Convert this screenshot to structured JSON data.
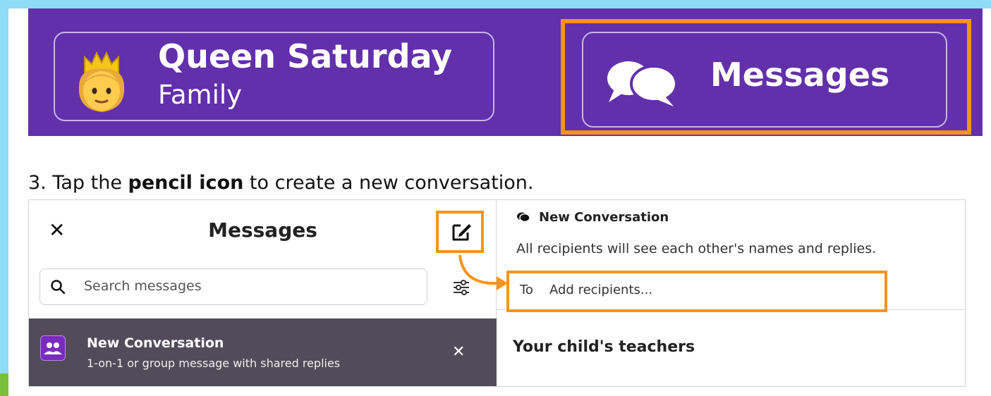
{
  "banner": {
    "profile_name": "Queen Saturday",
    "profile_role": "Family",
    "messages_label": "Messages",
    "background_color": "#6230ab"
  },
  "instruction": {
    "prefix": "3. Tap the ",
    "emphasis": "pencil icon",
    "suffix": " to create a new conversation."
  },
  "sidebar": {
    "title": "Messages",
    "close_icon": "x-icon",
    "compose_icon": "pencil-square-icon",
    "search_placeholder": "Search messages",
    "filter_icon": "sliders-icon"
  },
  "conversation_item": {
    "title": "New Conversation",
    "subtitle": "1-on-1 or group message with shared replies",
    "avatar_icon": "people-icon",
    "close_icon": "x-icon"
  },
  "composer": {
    "title": "New Conversation",
    "note": "All recipients will see each other's names and replies.",
    "to_label": "To",
    "to_placeholder": "Add recipients...",
    "teachers_heading": "Your child's teachers"
  },
  "highlight_color": "#f7941d"
}
